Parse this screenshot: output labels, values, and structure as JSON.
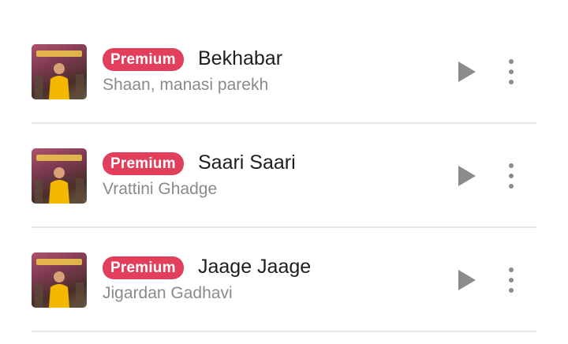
{
  "songs": [
    {
      "badge": "Premium",
      "title": "Bekhabar",
      "artist": "Shaan, manasi parekh",
      "thumbnail_icon": "album-art"
    },
    {
      "badge": "Premium",
      "title": "Saari Saari",
      "artist": "Vrattini Ghadge",
      "thumbnail_icon": "album-art"
    },
    {
      "badge": "Premium",
      "title": "Jaage Jaage",
      "artist": "Jigardan Gadhavi",
      "thumbnail_icon": "album-art"
    }
  ],
  "colors": {
    "premium_badge": "#e23f5c",
    "title_text": "#1e1e1e",
    "artist_text": "#8a8a8a",
    "icon_gray": "#8c8c8c",
    "divider": "#e6e6e6"
  }
}
